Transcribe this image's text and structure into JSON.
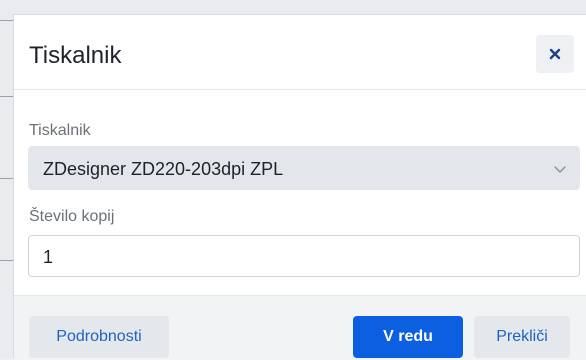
{
  "dialog": {
    "title": "Tiskalnik",
    "close_icon": "close-icon"
  },
  "printer_field": {
    "label": "Tiskalnik",
    "selected_value": "ZDesigner ZD220-203dpi ZPL",
    "dropdown_icon": "chevron-down-icon"
  },
  "copies_field": {
    "label": "Število kopij",
    "value": "1"
  },
  "footer": {
    "details_label": "Podrobnosti",
    "ok_label": "V redu",
    "cancel_label": "Prekliči"
  },
  "colors": {
    "primary_button": "#0b5fe0",
    "link_text": "#1e63c6",
    "select_background": "#e3e6ea",
    "footer_background": "#f2f3f5"
  }
}
